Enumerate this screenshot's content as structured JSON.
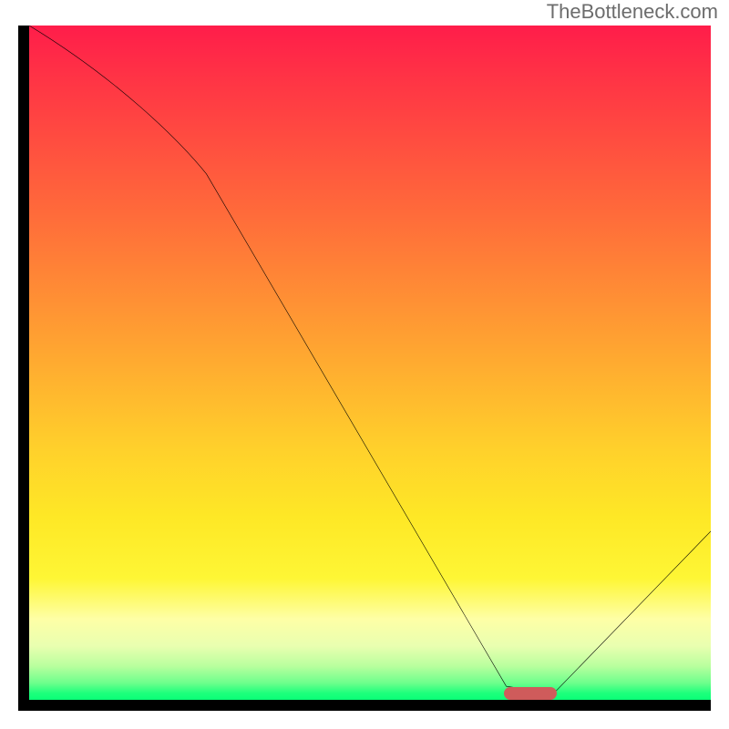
{
  "watermark": "TheBottleneck.com",
  "chart_data": {
    "type": "line",
    "title": "",
    "xlabel": "",
    "ylabel": "",
    "xlim": [
      0,
      100
    ],
    "ylim": [
      0,
      100
    ],
    "grid": false,
    "legend": false,
    "series": [
      {
        "name": "bottleneck-curve",
        "x": [
          0,
          26,
          70,
          77,
          100
        ],
        "y": [
          100,
          78,
          2,
          1,
          25
        ],
        "notes": "Piecewise: slight curve 0→26, straight 26→70, flat plateau 70→77 near y≈1, rise 77→100"
      }
    ],
    "annotations": [
      {
        "name": "optimal-marker",
        "shape": "rounded-rect",
        "color": "#cf5b5b",
        "x_center": 73.5,
        "y_center": 1,
        "width_x_units": 7.8,
        "height_y_units": 1.9
      }
    ],
    "background": {
      "type": "vertical-gradient",
      "stops": [
        {
          "pos": 0.0,
          "color": "#ff1d4a"
        },
        {
          "pos": 0.48,
          "color": "#ffa531"
        },
        {
          "pos": 0.73,
          "color": "#fee826"
        },
        {
          "pos": 0.92,
          "color": "#e9ffb0"
        },
        {
          "pos": 1.0,
          "color": "#0aff77"
        }
      ]
    }
  },
  "marker_color": "#cf5b5b"
}
